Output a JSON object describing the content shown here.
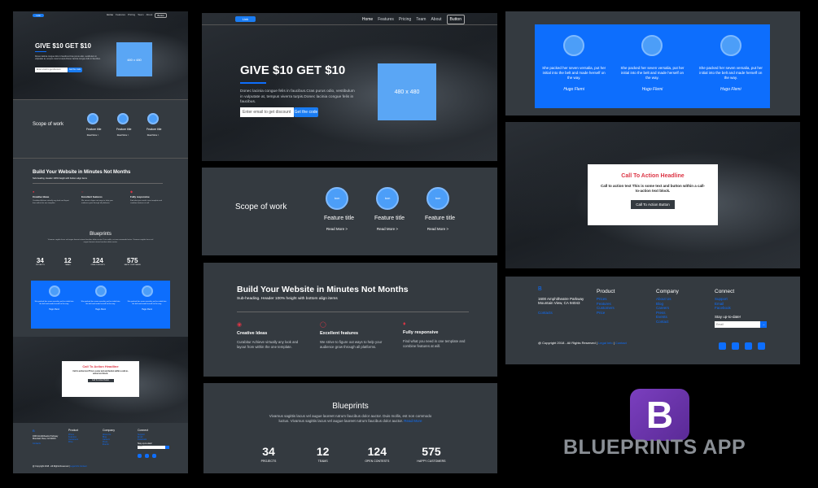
{
  "colors": {
    "accent": "#0d6efd",
    "dark": "#343a40",
    "cta_red": "#dc3545"
  },
  "nav": {
    "brand": "Link",
    "links": [
      "Home",
      "Features",
      "Pricing",
      "Team",
      "About"
    ],
    "button": "Button"
  },
  "hero": {
    "title": "GIVE $10 GET $10",
    "text": "Donec lacinia congue felis in faucibus.Cras purus odio, vestibulum in vulputate at, tempus viverra turpis.Donec lacinia congue felis in faucibus.",
    "placeholder": "Enter email to get discount",
    "button": "Get the code",
    "image_label": "480 x 480"
  },
  "scope": {
    "title": "Scope of work",
    "features": [
      {
        "circle": "Icon",
        "title": "Feature title",
        "link": "Read More >"
      },
      {
        "circle": "Icon",
        "title": "Feature title",
        "link": "Read More >"
      },
      {
        "circle": "Icon",
        "title": "Feature title",
        "link": "Read More >"
      }
    ]
  },
  "build": {
    "title": "Build Your Website in Minutes Not Months",
    "subtitle": "Sub-heading. Header 100% height with bottom align items",
    "items": [
      {
        "title": "Creative Ideas",
        "text": "Curabitur Achieve virtually any look and layout from within the one template."
      },
      {
        "title": "Excellent features",
        "text": "We strive to figure out ways to help your audience grow through all platforms."
      },
      {
        "title": "Fully responsive",
        "text": "Find what you need in one template and combine features at will."
      }
    ]
  },
  "blueprints": {
    "title": "Blueprints",
    "text": "Vivamus sagittis lacus vel augue laoreet rutrum faucibus dolor auctor. Duis mollis, est non commodo luctus. Vivamus sagittis lacus vel augue laoreet rutrum faucibus dolor auctor.",
    "link": "Read More",
    "stats": [
      {
        "value": "34",
        "label": "PROJECTS"
      },
      {
        "value": "12",
        "label": "TEAMS"
      },
      {
        "value": "124",
        "label": "OPEN CONTESTS"
      },
      {
        "value": "575",
        "label": "HAPPY CUSTOMERS"
      }
    ]
  },
  "testimonials": {
    "items": [
      {
        "quote": "She packed her seven versalia, put her initial into the belt and made herself on the way.",
        "author": "Hugo Flemi"
      },
      {
        "quote": "She packed her seven versalia, put her initial into the belt and made herself on the way.",
        "author": "Hugo Flemi"
      },
      {
        "quote": "She packed her seven versalia, put her initial into the belt and made herself on the way.",
        "author": "Hugo Flemi"
      }
    ]
  },
  "cta": {
    "headline": "Call To Action Headline",
    "text": "Call to action text This is some text and button within a call-to-action text block.",
    "button": "Call To Action Button"
  },
  "footer": {
    "logo": "B",
    "address1": "1600 Amphitheatre Parkway",
    "address2": "Mountain View, CA 94043",
    "contacts": "Contacts",
    "product_title": "Product",
    "product_links": [
      "Prices",
      "Features",
      "Customers",
      "Price"
    ],
    "company_title": "Company",
    "company_links": [
      "About Us",
      "Blog",
      "Careers",
      "Press",
      "Events",
      "Contact"
    ],
    "connect_title": "Connect",
    "connect_links": [
      "Support",
      "Email",
      "Facebook"
    ],
    "stay_label": "Stay up-to-date!",
    "email_placeholder": "Email",
    "copyright": "@ Copyright 2018 - All Rights Reserved |",
    "legal": "Legal Info",
    "contact": "Contact"
  },
  "app_badge": {
    "letter": "B",
    "title": "BLUEPRINTS APP"
  }
}
